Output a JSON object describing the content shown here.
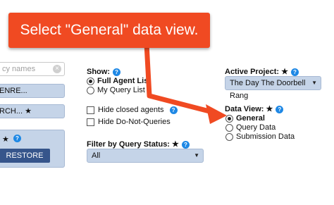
{
  "callout": {
    "text": "Select \"General\" data view."
  },
  "left_panel": {
    "search_placeholder": "cy names",
    "clear_glyph": "×",
    "genre_button": "ENRE...",
    "search_button": "RCH...",
    "star": "★",
    "panel_star": "★",
    "restore_button": "RESTORE"
  },
  "show": {
    "label": "Show:",
    "options": [
      "Full Agent List",
      "My Query List"
    ],
    "selected": "Full Agent List"
  },
  "checkboxes": [
    {
      "label": "Hide closed agents",
      "checked": false
    },
    {
      "label": "Hide Do-Not-Queries",
      "checked": false
    }
  ],
  "filter": {
    "label": "Filter by Query Status:",
    "star": "★",
    "value": "All"
  },
  "active_project": {
    "label": "Active Project:",
    "star": "★",
    "value": "The Day The Doorbell Rang"
  },
  "data_view": {
    "label": "Data View:",
    "star": "★",
    "options": [
      "General",
      "Query Data",
      "Submission Data"
    ],
    "selected": "General"
  },
  "colors": {
    "callout": "#f04a22",
    "panel": "#c5d4e8",
    "restore": "#36558b",
    "help_icon": "#1e88e5"
  },
  "icons": {
    "help": "?",
    "caret": "▼"
  }
}
